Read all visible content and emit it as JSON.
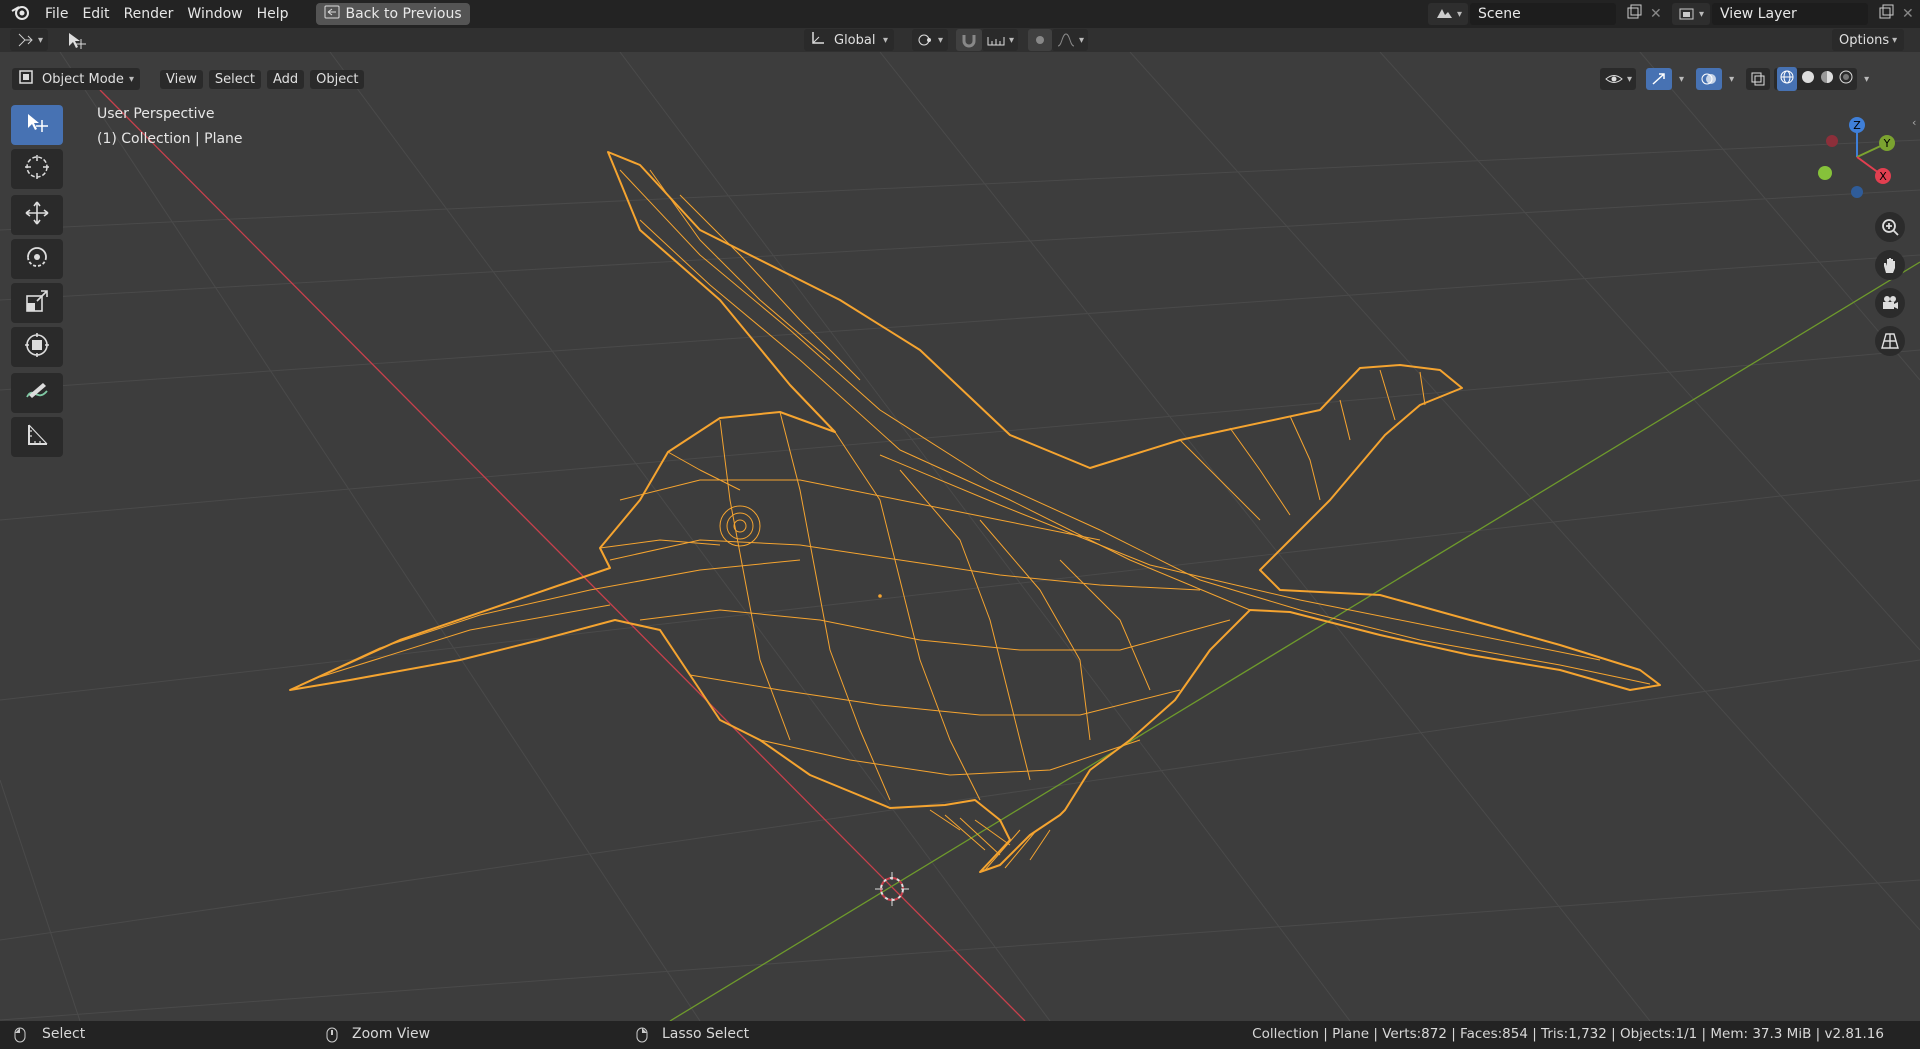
{
  "app": {
    "logo_icon": "blender-logo-icon"
  },
  "menu": {
    "file": "File",
    "edit": "Edit",
    "render": "Render",
    "window": "Window",
    "help": "Help"
  },
  "back_button": {
    "label": "Back to Previous",
    "icon": "back-icon"
  },
  "scene": {
    "label": "Scene"
  },
  "view_layer": {
    "label": "View Layer"
  },
  "tool_header": {
    "orientation": "Global",
    "options": "Options"
  },
  "viewport_header": {
    "mode": "Object Mode",
    "menus": {
      "view": "View",
      "select": "Select",
      "add": "Add",
      "object": "Object"
    }
  },
  "viewport": {
    "perspective": "User Perspective",
    "collection_info": "(1) Collection | Plane",
    "gizmo": {
      "z": "Z",
      "y": "Y",
      "x": "X"
    }
  },
  "tools": [
    {
      "name": "select-box",
      "icon": "select-box-icon",
      "active": true
    },
    {
      "name": "cursor",
      "icon": "cursor-icon",
      "active": false
    },
    {
      "name": "move",
      "icon": "move-icon",
      "active": false
    },
    {
      "name": "rotate",
      "icon": "rotate-icon",
      "active": false
    },
    {
      "name": "scale",
      "icon": "scale-icon",
      "active": false
    },
    {
      "name": "transform",
      "icon": "transform-icon",
      "active": false
    },
    {
      "name": "annotate",
      "icon": "annotate-icon",
      "active": false
    },
    {
      "name": "measure",
      "icon": "measure-icon",
      "active": false
    }
  ],
  "status": {
    "select": "Select",
    "zoom_view": "Zoom View",
    "lasso_select": "Lasso Select",
    "stats": "Collection | Plane | Verts:872 | Faces:854 | Tris:1,732 | Objects:1/1 | Mem: 37.3 MiB | v2.81.16"
  },
  "colors": {
    "accent": "#4772b3",
    "selection": "#f5a430",
    "x_axis": "#c8404c",
    "y_axis": "#6e9a2c",
    "header_bg": "#232323",
    "viewport_bg": "#3d3d3d"
  }
}
